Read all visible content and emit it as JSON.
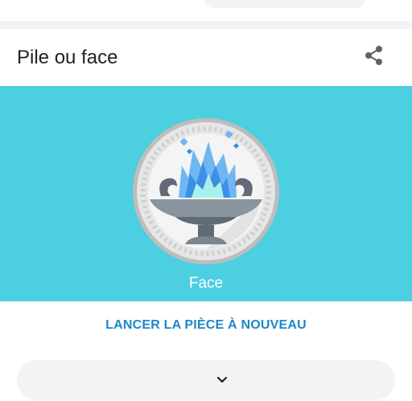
{
  "header": {
    "title": "Pile ou face"
  },
  "coin": {
    "result_label": "Face"
  },
  "actions": {
    "flip_again_label": "LANCER LA PIÈCE À NOUVEAU"
  },
  "icons": {
    "share": "share-icon",
    "expand": "chevron-down-icon",
    "coin": "coin-face-icon"
  },
  "colors": {
    "stage_background": "#4ccfe0",
    "accent": "#1a88c9",
    "title_text": "#202124",
    "pill_background": "#f1f3f4"
  }
}
